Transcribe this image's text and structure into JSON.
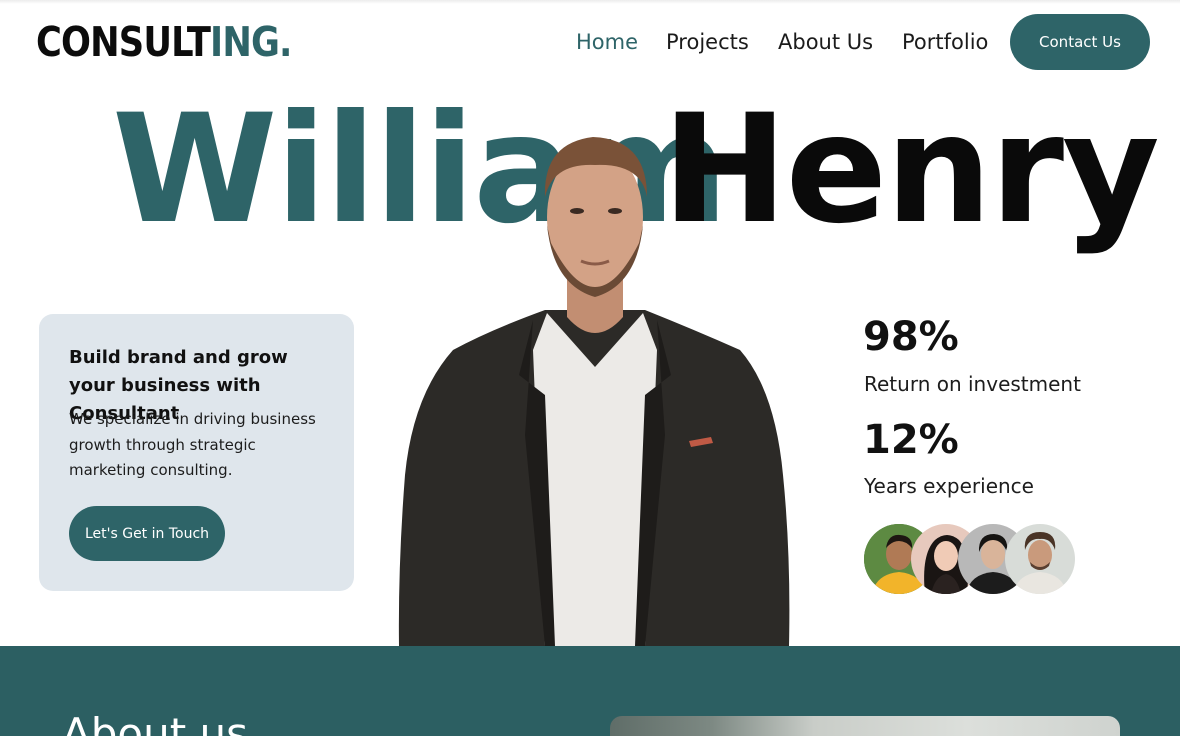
{
  "header": {
    "logo_part1": "CONSULT",
    "logo_part2": "ING.",
    "nav": [
      {
        "label": "Home",
        "active": true
      },
      {
        "label": "Projects",
        "active": false
      },
      {
        "label": "About Us",
        "active": false
      },
      {
        "label": "Portfolio",
        "active": false
      }
    ],
    "contact_label": "Contact Us"
  },
  "hero": {
    "first_name": "William",
    "last_name": "Henry",
    "card": {
      "title": "Build brand and grow your business with Consultant",
      "text": "We specialize in driving business growth through strategic marketing consulting.",
      "button_label": "Let's Get in Touch"
    },
    "stats": [
      {
        "value": "98%",
        "label": "Return on investment"
      },
      {
        "value": "12%",
        "label": "Years experience"
      }
    ]
  },
  "about": {
    "title": "About us"
  },
  "colors": {
    "accent": "#2e6468",
    "card_background": "#dfe6ec",
    "about_background": "#2c5f62"
  },
  "icons": {
    "portrait": "man-portrait-image",
    "avatars": [
      "avatar-man-yellow-shirt",
      "avatar-woman",
      "avatar-man-dark",
      "avatar-man-curly"
    ]
  }
}
